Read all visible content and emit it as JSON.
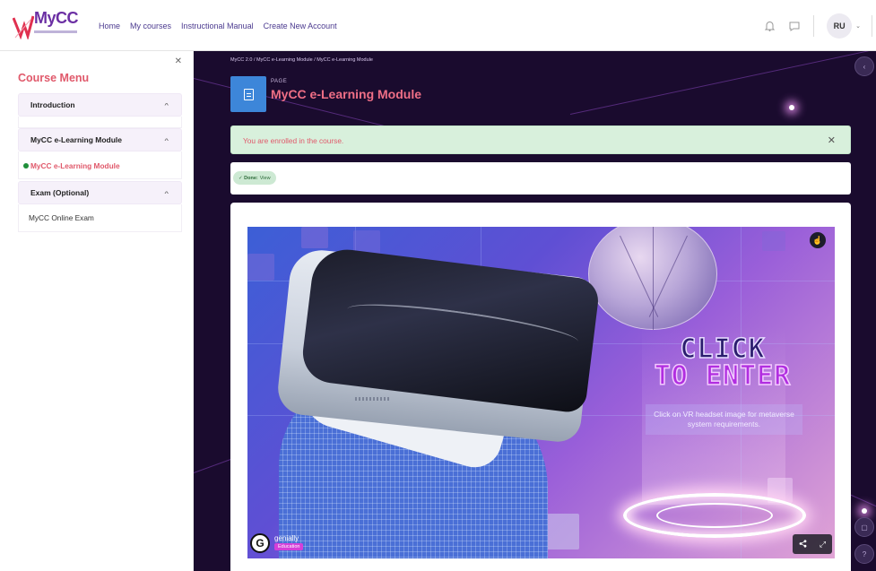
{
  "brand": {
    "name": "MyCC"
  },
  "nav": {
    "items": [
      "Home",
      "My courses",
      "Instructional Manual",
      "Create New Account"
    ],
    "avatar_initials": "RU"
  },
  "sidebar": {
    "title": "Course Menu",
    "sections": [
      {
        "label": "Introduction"
      },
      {
        "label": "MyCC e-Learning Module",
        "items": [
          "MyCC e-Learning Module"
        ]
      },
      {
        "label": "Exam (Optional)",
        "items": [
          "MyCC Online Exam"
        ]
      }
    ]
  },
  "page": {
    "breadcrumb": "MyCC 2.0 / MyCC e-Learning Module / MyCC e-Learning Module",
    "type_label": "PAGE",
    "title": "MyCC e-Learning Module",
    "alert": "You are enrolled in the course.",
    "completion": {
      "prefix": "Done:",
      "text": "View"
    }
  },
  "embed": {
    "headline_1": "CLICK",
    "headline_2": "TO ENTER",
    "note": "Click on VR headset image for metaverse system requirements.",
    "brand": "genially",
    "brand_tag": "Education"
  },
  "icons": {
    "bell": "bell-icon",
    "chat": "chat-icon",
    "close": "close-icon",
    "page": "page-icon",
    "share": "share-icon",
    "fullscreen": "fullscreen-icon"
  },
  "colors": {
    "brand_purple": "#6b2fa3",
    "accent_red": "#e0596b",
    "alert_bg": "#d8f0dc",
    "page_icon_blue": "#3d86d9"
  }
}
